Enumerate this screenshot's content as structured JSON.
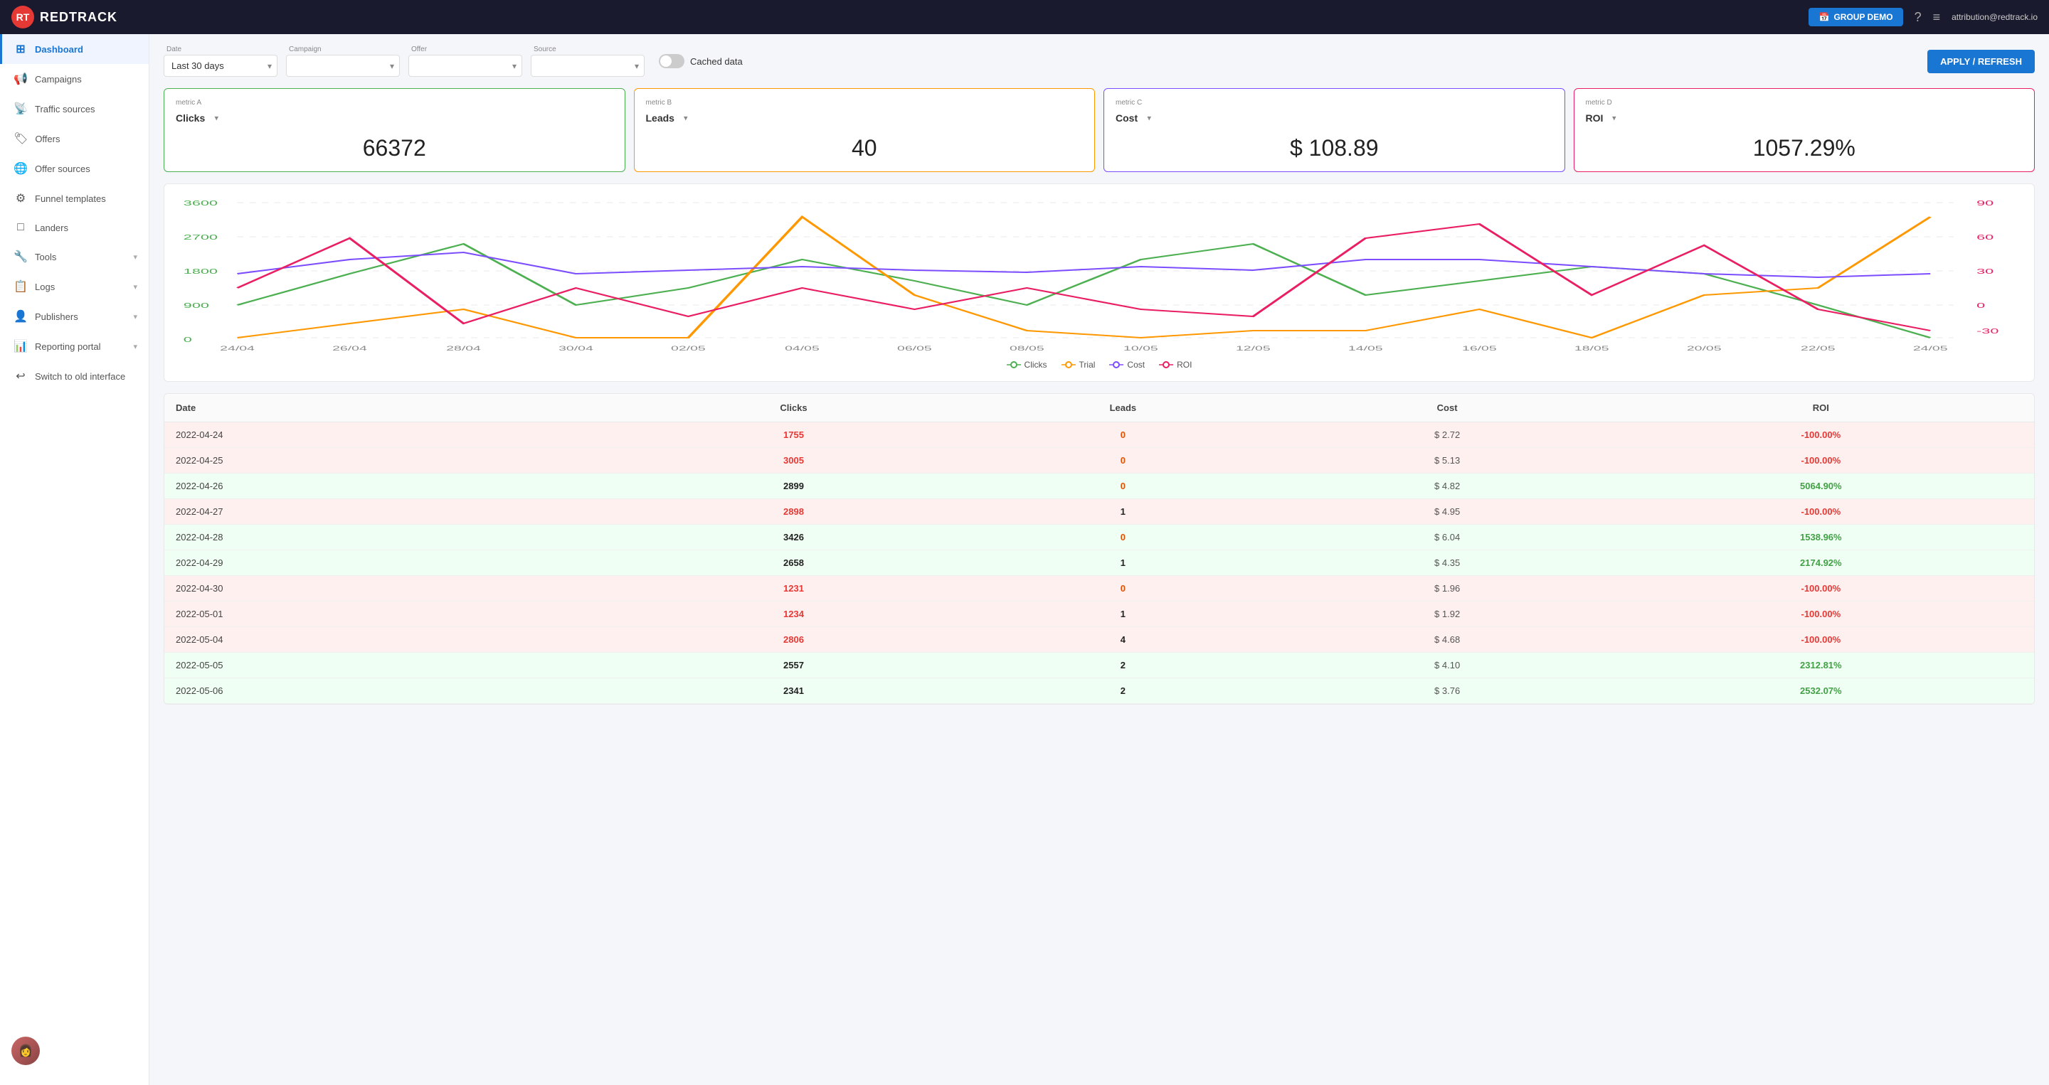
{
  "app": {
    "logo_initials": "RT",
    "logo_name": "REDTRACK",
    "group_demo": "GROUP DEMO",
    "user_email": "attribution@redtrack.io"
  },
  "sidebar": {
    "items": [
      {
        "id": "dashboard",
        "label": "Dashboard",
        "icon": "⊞",
        "active": true,
        "has_arrow": false
      },
      {
        "id": "campaigns",
        "label": "Campaigns",
        "icon": "📢",
        "active": false,
        "has_arrow": false
      },
      {
        "id": "traffic-sources",
        "label": "Traffic sources",
        "icon": "📡",
        "active": false,
        "has_arrow": false
      },
      {
        "id": "offers",
        "label": "Offers",
        "icon": "🏷",
        "active": false,
        "has_arrow": false
      },
      {
        "id": "offer-sources",
        "label": "Offer sources",
        "icon": "🌐",
        "active": false,
        "has_arrow": false
      },
      {
        "id": "funnel-templates",
        "label": "Funnel templates",
        "icon": "⚙",
        "active": false,
        "has_arrow": false
      },
      {
        "id": "landers",
        "label": "Landers",
        "icon": "□",
        "active": false,
        "has_arrow": false
      },
      {
        "id": "tools",
        "label": "Tools",
        "icon": "🔧",
        "active": false,
        "has_arrow": true
      },
      {
        "id": "logs",
        "label": "Logs",
        "icon": "📋",
        "active": false,
        "has_arrow": true
      },
      {
        "id": "publishers",
        "label": "Publishers",
        "icon": "👤",
        "active": false,
        "has_arrow": true
      },
      {
        "id": "reporting-portal",
        "label": "Reporting portal",
        "icon": "📊",
        "active": false,
        "has_arrow": true
      },
      {
        "id": "switch-old",
        "label": "Switch to old interface",
        "icon": "↩",
        "active": false,
        "has_arrow": false
      }
    ]
  },
  "filters": {
    "date_label": "Date",
    "date_value": "Last 30 days",
    "campaign_label": "Campaign",
    "campaign_value": "",
    "offer_label": "Offer",
    "offer_value": "",
    "source_label": "Source",
    "source_value": "",
    "cached_label": "Cached data",
    "apply_label": "APPLY / REFRESH"
  },
  "metrics": [
    {
      "id": "A",
      "label": "metric A",
      "value": "Clicks",
      "display": "66372",
      "border_color": "green"
    },
    {
      "id": "B",
      "label": "metric B",
      "value": "Leads",
      "display": "40",
      "border_color": "orange"
    },
    {
      "id": "C",
      "label": "metric C",
      "value": "Cost",
      "display": "$ 108.89",
      "border_color": "purple"
    },
    {
      "id": "D",
      "label": "metric D",
      "value": "ROI",
      "display": "1057.29%",
      "border_color": "pink"
    }
  ],
  "chart": {
    "legend": [
      {
        "label": "Clicks",
        "color": "#4caf50"
      },
      {
        "label": "Trial",
        "color": "#ff9800"
      },
      {
        "label": "Cost",
        "color": "#7c4dff"
      },
      {
        "label": "ROI",
        "color": "#e91e63"
      }
    ],
    "x_labels": [
      "24/04",
      "26/04",
      "28/04",
      "30/04",
      "02/05",
      "04/05",
      "06/05",
      "08/05",
      "10/05",
      "12/05",
      "14/05",
      "16/05",
      "18/05",
      "20/05",
      "22/05",
      "24/05"
    ]
  },
  "table": {
    "columns": [
      "Date",
      "Clicks",
      "Leads",
      "Cost",
      "ROI"
    ],
    "rows": [
      {
        "date": "2022-04-24",
        "clicks": "1755",
        "leads": "0",
        "cost": "$ 2.72",
        "roi": "-100.00%",
        "row_class": "row-red",
        "clicks_class": "val-red",
        "leads_class": "val-orange",
        "roi_class": "roi-neg"
      },
      {
        "date": "2022-04-25",
        "clicks": "3005",
        "leads": "0",
        "cost": "$ 5.13",
        "roi": "-100.00%",
        "row_class": "row-red",
        "clicks_class": "val-red",
        "leads_class": "val-orange",
        "roi_class": "roi-neg"
      },
      {
        "date": "2022-04-26",
        "clicks": "2899",
        "leads": "0",
        "cost": "$ 4.82",
        "roi": "5064.90%",
        "row_class": "row-green",
        "clicks_class": "val-green",
        "leads_class": "val-orange",
        "roi_class": "roi-pos"
      },
      {
        "date": "2022-04-27",
        "clicks": "2898",
        "leads": "1",
        "cost": "$ 4.95",
        "roi": "-100.00%",
        "row_class": "row-red",
        "clicks_class": "val-red",
        "leads_class": "val-green",
        "roi_class": "roi-neg"
      },
      {
        "date": "2022-04-28",
        "clicks": "3426",
        "leads": "0",
        "cost": "$ 6.04",
        "roi": "1538.96%",
        "row_class": "row-green",
        "clicks_class": "val-green",
        "leads_class": "val-orange",
        "roi_class": "roi-pos"
      },
      {
        "date": "2022-04-29",
        "clicks": "2658",
        "leads": "1",
        "cost": "$ 4.35",
        "roi": "2174.92%",
        "row_class": "row-green",
        "clicks_class": "val-green",
        "leads_class": "val-green",
        "roi_class": "roi-pos"
      },
      {
        "date": "2022-04-30",
        "clicks": "1231",
        "leads": "0",
        "cost": "$ 1.96",
        "roi": "-100.00%",
        "row_class": "row-red",
        "clicks_class": "val-red",
        "leads_class": "val-orange",
        "roi_class": "roi-neg"
      },
      {
        "date": "2022-05-01",
        "clicks": "1234",
        "leads": "1",
        "cost": "$ 1.92",
        "roi": "-100.00%",
        "row_class": "row-red",
        "clicks_class": "val-red",
        "leads_class": "val-green",
        "roi_class": "roi-neg"
      },
      {
        "date": "2022-05-04",
        "clicks": "2806",
        "leads": "4",
        "cost": "$ 4.68",
        "roi": "-100.00%",
        "row_class": "row-red",
        "clicks_class": "val-red",
        "leads_class": "val-green",
        "roi_class": "roi-neg"
      },
      {
        "date": "2022-05-05",
        "clicks": "2557",
        "leads": "2",
        "cost": "$ 4.10",
        "roi": "2312.81%",
        "row_class": "row-green",
        "clicks_class": "val-green",
        "leads_class": "val-green",
        "roi_class": "roi-pos"
      },
      {
        "date": "2022-05-06",
        "clicks": "2341",
        "leads": "2",
        "cost": "$ 3.76",
        "roi": "2532.07%",
        "row_class": "row-green",
        "clicks_class": "val-green",
        "leads_class": "val-green",
        "roi_class": "roi-pos"
      }
    ]
  }
}
